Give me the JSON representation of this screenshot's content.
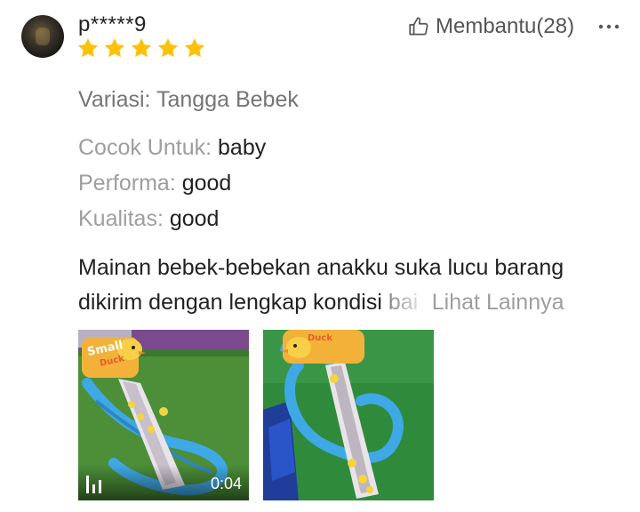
{
  "review": {
    "username": "p*****9",
    "rating": 5,
    "rating_max": 5,
    "helpful_label": "Membantu(28)",
    "variation": "Variasi: Tangga Bebek",
    "attributes": [
      {
        "label": "Cocok Untuk:",
        "value": "baby"
      },
      {
        "label": "Performa:",
        "value": "good"
      },
      {
        "label": "Kualitas:",
        "value": "good"
      }
    ],
    "text_line1": "Mainan bebek-bebekan anakku suka lucu barang",
    "text_line2": "dikirim dengan lengkap kondisi",
    "text_faded": "bai",
    "see_more": "Lihat Lainnya",
    "media": [
      {
        "type": "video",
        "label_top": "Small",
        "label_sub": "Duck",
        "duration": "0:04"
      },
      {
        "type": "image",
        "label_sub": "Duck"
      }
    ]
  },
  "colors": {
    "star": "#FFC107",
    "muted_text": "#9E9E9E",
    "body_text": "#222222",
    "track_blue": "#3FA9E6",
    "grass_green": "#3E8E3E"
  },
  "icons": [
    "thumbs-up-icon",
    "more-options-icon",
    "star-icon",
    "volume-bars-icon"
  ]
}
